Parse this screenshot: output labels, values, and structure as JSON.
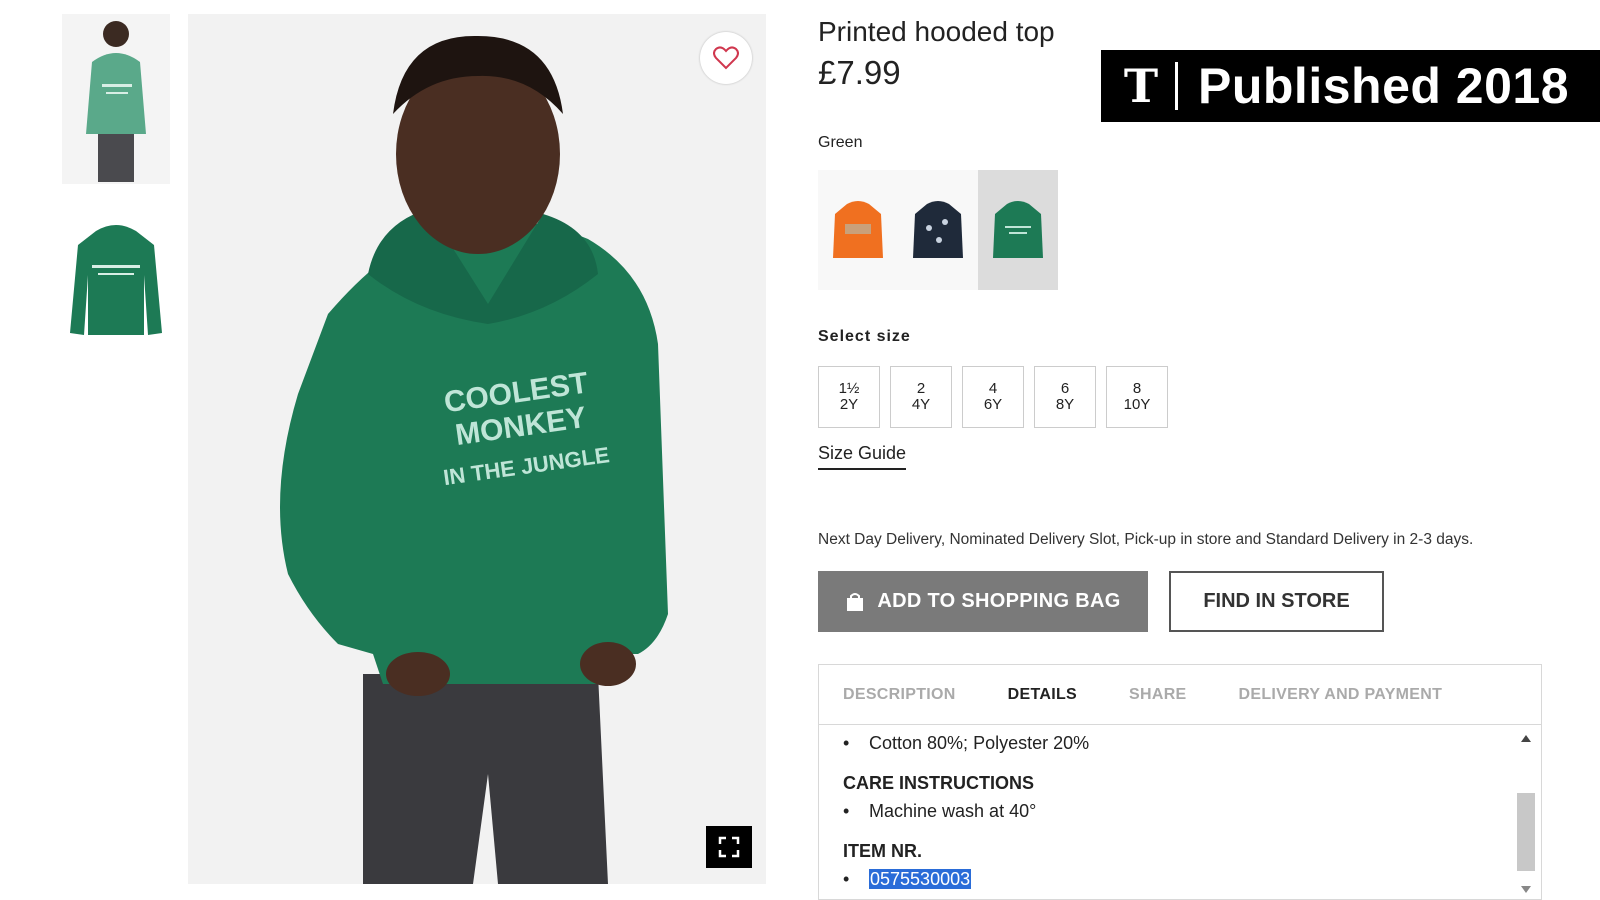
{
  "thumbnails": [
    {
      "name": "thumb-model",
      "alt": "model wearing hoodie"
    },
    {
      "name": "thumb-product",
      "alt": "hoodie flat"
    }
  ],
  "hoodie_print": {
    "line1": "COOLEST MONKEY",
    "line2": "IN THE JUNGLE"
  },
  "product": {
    "title": "Printed hooded top",
    "price": "£7.99",
    "color_label": "Green"
  },
  "swatches": [
    {
      "color": "#f07020",
      "selected": false
    },
    {
      "color": "#1f2a3a",
      "selected": false
    },
    {
      "color": "#1d7a55",
      "selected": true
    }
  ],
  "sizes": {
    "label": "Select size",
    "options": [
      {
        "line1": "1½",
        "line2": "2Y"
      },
      {
        "line1": "2",
        "line2": "4Y"
      },
      {
        "line1": "4",
        "line2": "6Y"
      },
      {
        "line1": "6",
        "line2": "8Y"
      },
      {
        "line1": "8",
        "line2": "10Y"
      }
    ],
    "guide_label": "Size Guide"
  },
  "delivery_text": "Next Day Delivery, Nominated Delivery Slot, Pick-up in store and Standard Delivery in 2-3 days.",
  "actions": {
    "add_to_bag": "ADD TO SHOPPING BAG",
    "find_in_store": "FIND IN STORE"
  },
  "tabs": [
    {
      "label": "DESCRIPTION",
      "active": false
    },
    {
      "label": "DETAILS",
      "active": true
    },
    {
      "label": "SHARE",
      "active": false
    },
    {
      "label": "DELIVERY AND PAYMENT",
      "active": false
    }
  ],
  "details": {
    "composition": "Cotton 80%; Polyester 20%",
    "care_heading": "CARE INSTRUCTIONS",
    "care_item": "Machine wash at 40°",
    "item_heading": "ITEM NR.",
    "item_number": "0575530003"
  },
  "banner": {
    "logo": "T",
    "text": "Published 2018"
  },
  "colors": {
    "hoodie_green": "#1d7a55",
    "button_gray": "#7a7a7a",
    "highlight": "#2a6cd8"
  }
}
